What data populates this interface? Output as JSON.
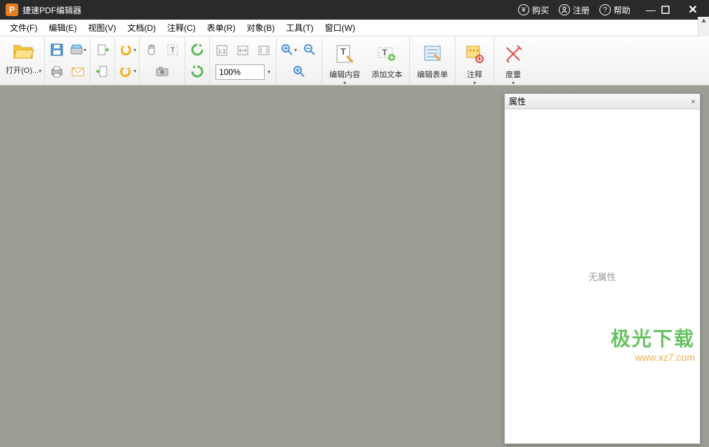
{
  "titlebar": {
    "logo_letter": "P",
    "title": "捷速PDF编辑器",
    "buy": "购买",
    "register": "注册",
    "help": "帮助"
  },
  "menubar": {
    "items": [
      "文件(F)",
      "编辑(E)",
      "视图(V)",
      "文档(D)",
      "注释(C)",
      "表单(R)",
      "对象(B)",
      "工具(T)",
      "窗口(W)"
    ]
  },
  "toolbar": {
    "open_label": "打开(O)...",
    "zoom_value": "100%",
    "edit_content": "编辑内容",
    "add_text": "添加文本",
    "edit_form": "编辑表单",
    "annotate": "注释",
    "measure": "度量"
  },
  "panel": {
    "title": "属性",
    "empty": "无属性"
  },
  "watermark": {
    "line1": "极光下载",
    "line2": "www.xz7.com"
  }
}
